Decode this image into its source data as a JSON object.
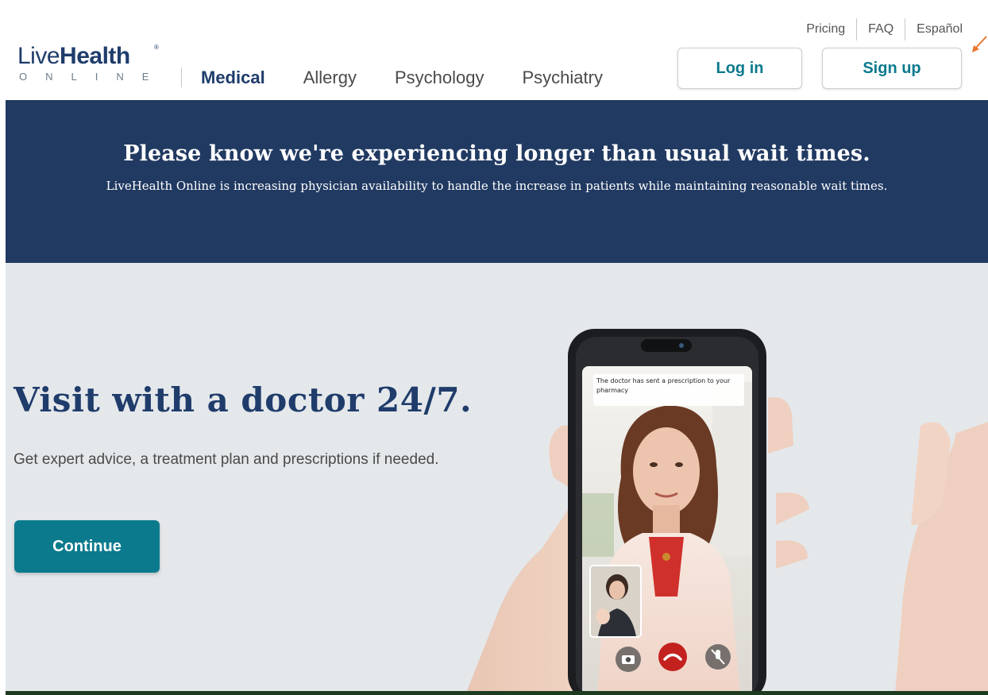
{
  "header": {
    "util_links": [
      "Pricing",
      "FAQ",
      "Español"
    ],
    "logo": {
      "word_light": "Live",
      "word_bold": "Health",
      "sub": "ONLINE",
      "reg": "®"
    },
    "nav": [
      {
        "label": "Medical",
        "active": true
      },
      {
        "label": "Allergy",
        "active": false
      },
      {
        "label": "Psychology",
        "active": false
      },
      {
        "label": "Psychiatry",
        "active": false
      }
    ],
    "login_label": "Log in",
    "signup_label": "Sign up"
  },
  "banner": {
    "title": "Please know we're experiencing longer than usual wait times.",
    "text": "LiveHealth Online is increasing physician availability to handle the increase in patients while maintaining reasonable wait times."
  },
  "hero": {
    "title": "Visit with a doctor 24/7.",
    "subtitle": "Get expert advice, a treatment plan and prescriptions if needed.",
    "cta_label": "Continue",
    "phone_notice": "The doctor has sent a prescription to your pharmacy"
  },
  "colors": {
    "brand_navy": "#1f3c6b",
    "banner_bg": "#213a62",
    "teal": "#0b7a8d",
    "hero_bg": "#e4e8eb",
    "arrow": "#e8782c"
  },
  "icons": [
    "camera-icon",
    "end-call-icon",
    "mute-mic-icon",
    "annotation-arrow-icon"
  ]
}
